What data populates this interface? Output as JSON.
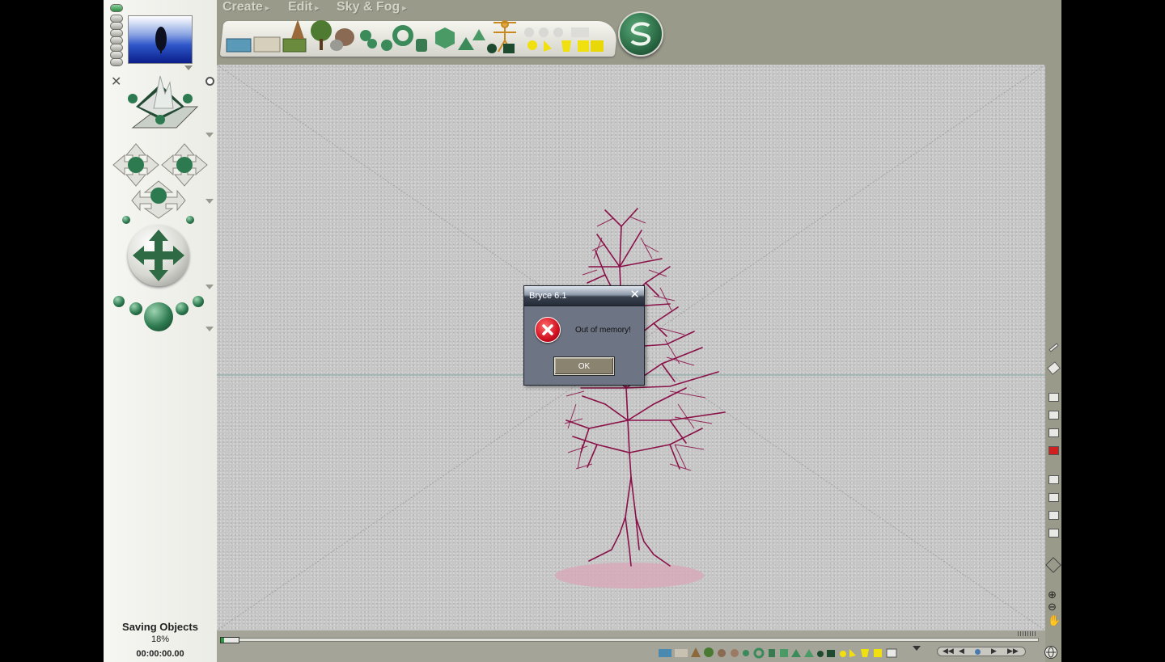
{
  "menu": {
    "create": "Create",
    "edit": "Edit",
    "sky_fog": "Sky & Fog"
  },
  "create_tray": {
    "object_icons": [
      "water-plane-icon",
      "infinite-plane-icon",
      "ground-icon",
      "stone-icon",
      "terrain-icon",
      "tree-icon",
      "rock-icon",
      "metaball-icon",
      "torus-icon",
      "sphere-icon",
      "cylinder-icon",
      "cube-icon",
      "pyramid-icon",
      "cone-icon",
      "human-figure-icon",
      "disk-icon",
      "square-icon",
      "light-icon"
    ]
  },
  "status": {
    "title": "Saving Objects",
    "percent": "18%",
    "time": "00:00:00.00",
    "progress": 0.18
  },
  "dialog": {
    "title": "Bryce 6.1",
    "close": "✕",
    "message": "Out of memory!",
    "ok_label": "OK"
  },
  "colors": {
    "app_background": "#9a9a8a",
    "viewport_background": "#c6c6c6",
    "tree_color": "#8a1048",
    "tree_shadow": "#d8a8b8",
    "dialog_background": "#6d7484",
    "error_red": "#d01020"
  }
}
